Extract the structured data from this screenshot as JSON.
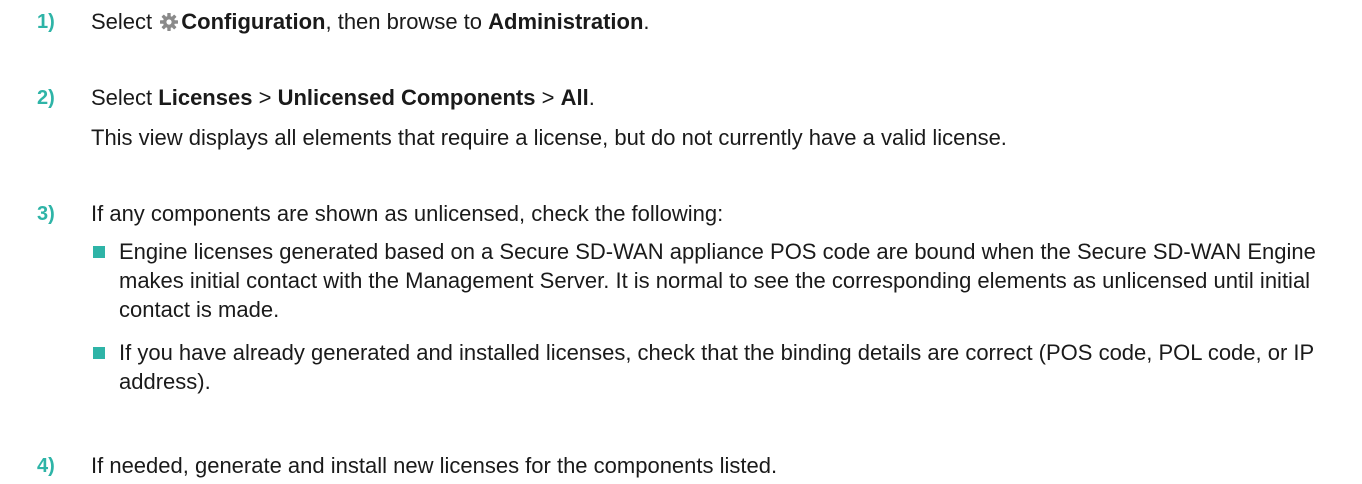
{
  "accent_color": "#2eb4a7",
  "steps": [
    {
      "number": "1)",
      "prefix": "Select",
      "icon": "gear-icon",
      "bold1": "Configuration",
      "middle": ", then browse to",
      "bold2": "Administration",
      "suffix": "."
    },
    {
      "number": "2)",
      "prefix": "Select",
      "bold1": "Licenses",
      "sep1": ">",
      "bold2": "Unlicensed Components",
      "sep2": ">",
      "bold3": "All",
      "suffix": ".",
      "note": "This view displays all elements that require a license, but do not currently have a valid license."
    },
    {
      "number": "3)",
      "text": "If any components are shown as unlicensed, check the following:",
      "bullets": [
        "Engine licenses generated based on a Secure SD-WAN appliance POS code are bound when the Secure SD-WAN Engine makes initial contact with the Management Server. It is normal to see the corresponding elements as unlicensed until initial contact is made.",
        "If you have already generated and installed licenses, check that the binding details are correct (POS code, POL code, or IP address)."
      ]
    },
    {
      "number": "4)",
      "text": "If needed, generate and install new licenses for the components listed."
    }
  ]
}
